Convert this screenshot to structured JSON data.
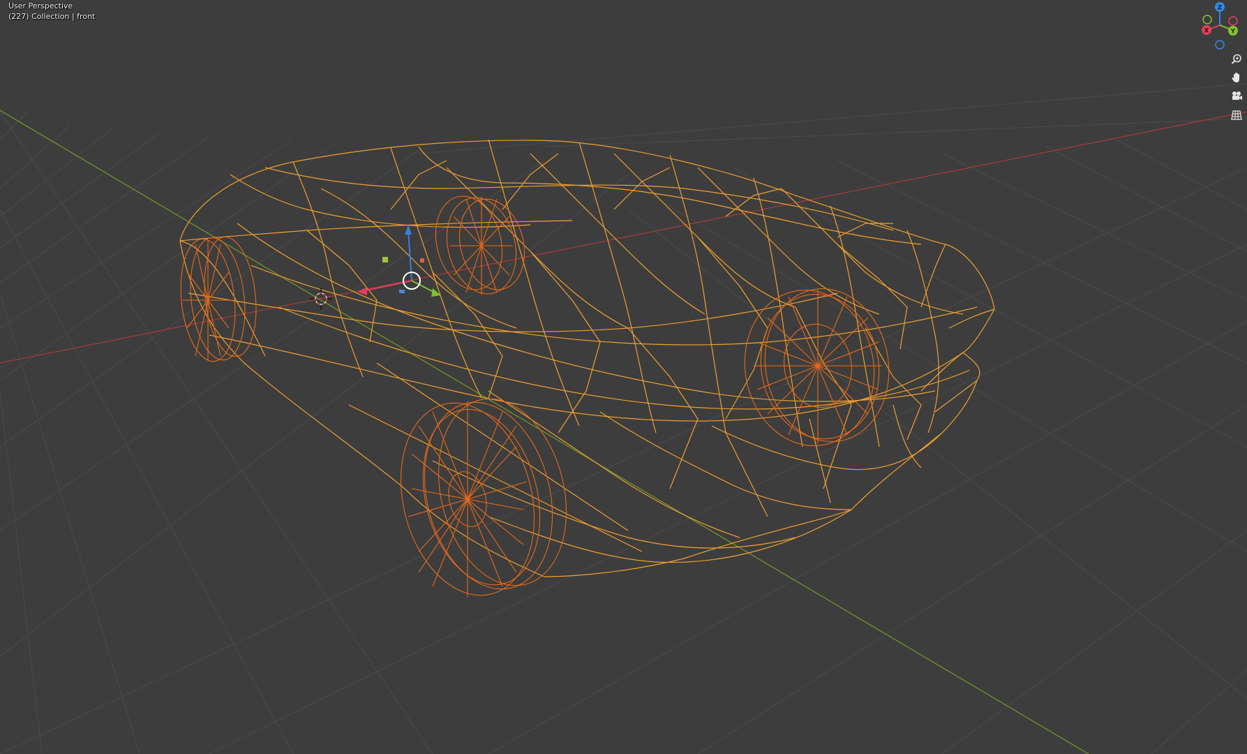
{
  "overlay": {
    "view_name": "User Perspective",
    "object_info": "(227) Collection | front"
  },
  "gizmo": {
    "axes": {
      "x": "X",
      "y": "Y",
      "z": "Z"
    },
    "colors": {
      "x": "#e0435a",
      "y": "#85c22c",
      "z": "#2f8be8"
    }
  },
  "nav_buttons": [
    "zoom-icon",
    "hand-pan-icon",
    "camera-icon",
    "grid-ortho-icon"
  ],
  "colors": {
    "background": "#3d3d3d",
    "grid_line": "#4a4a4a",
    "x_axis": "#9c3a3a",
    "y_axis": "#6c8f2a",
    "wire_body": "#f0a030",
    "wire_wheel": "#e86a1a"
  }
}
